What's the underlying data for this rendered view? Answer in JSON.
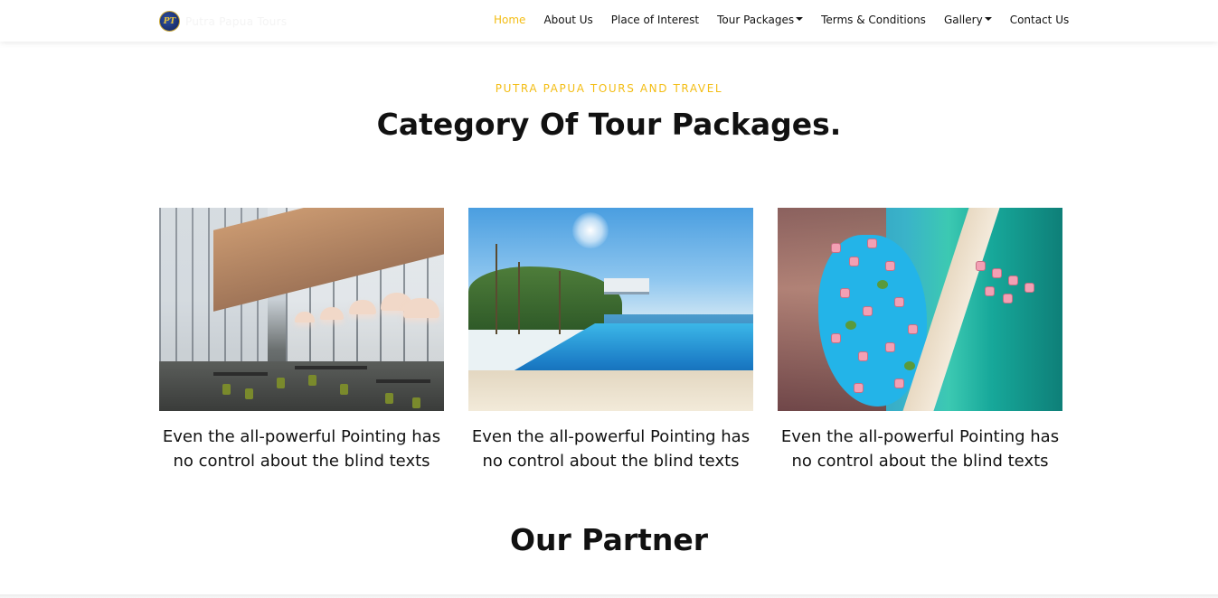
{
  "navbar": {
    "brand_text": "Putra Papua Tours",
    "logo_initials": "PT",
    "items": [
      {
        "label": "Home",
        "active": true,
        "dropdown": false
      },
      {
        "label": "About Us",
        "active": false,
        "dropdown": false
      },
      {
        "label": "Place of Interest",
        "active": false,
        "dropdown": false
      },
      {
        "label": "Tour Packages",
        "active": false,
        "dropdown": true
      },
      {
        "label": "Terms & Conditions",
        "active": false,
        "dropdown": false
      },
      {
        "label": "Gallery",
        "active": false,
        "dropdown": true
      },
      {
        "label": "Contact Us",
        "active": false,
        "dropdown": false
      }
    ]
  },
  "section": {
    "kicker": "PUTRA PAPUA TOURS AND TRAVEL",
    "title": "Category Of Tour Packages."
  },
  "cards": [
    {
      "image": "modern glass lounge interior with pendant lamps",
      "caption": "Even the all-powerful Pointing has no control about the blind texts"
    },
    {
      "image": "infinity pool overlooking the sea with palm trees",
      "caption": "Even the all-powerful Pointing has no control about the blind texts"
    },
    {
      "image": "aerial view of beach resort with lagoon pools and pink villas",
      "caption": "Even the all-powerful Pointing has no control about the blind texts"
    }
  ],
  "partner": {
    "title": "Our Partner"
  },
  "colors": {
    "accent": "#f3bd14",
    "text": "#111111",
    "background": "#ffffff"
  }
}
